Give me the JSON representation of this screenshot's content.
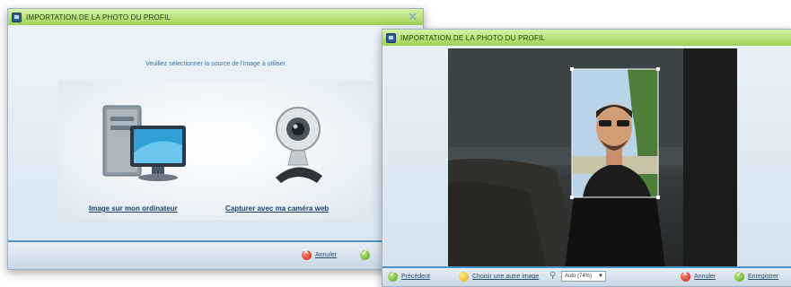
{
  "window1": {
    "title": "IMPORTATION DE LA PHOTO DU PROFIL",
    "prompt": "Veuillez sélectionner la source de l'image à utiliser",
    "choice_computer": "Image sur mon ordinateur",
    "choice_webcam": "Capturer avec ma caméra web",
    "cancel_label": "Annuler"
  },
  "window2": {
    "title": "IMPORTATION DE LA PHOTO DU PROFIL",
    "previous_label": "Précédent",
    "choose_other_label": "Choisir une autre image",
    "zoom_value": "Auto (74%)",
    "cancel_label": "Annuler",
    "save_label": "Enregistrer"
  },
  "colors": {
    "titlebar": "#9fd155",
    "accent_blue": "#4f92c6",
    "link": "#23416e"
  }
}
